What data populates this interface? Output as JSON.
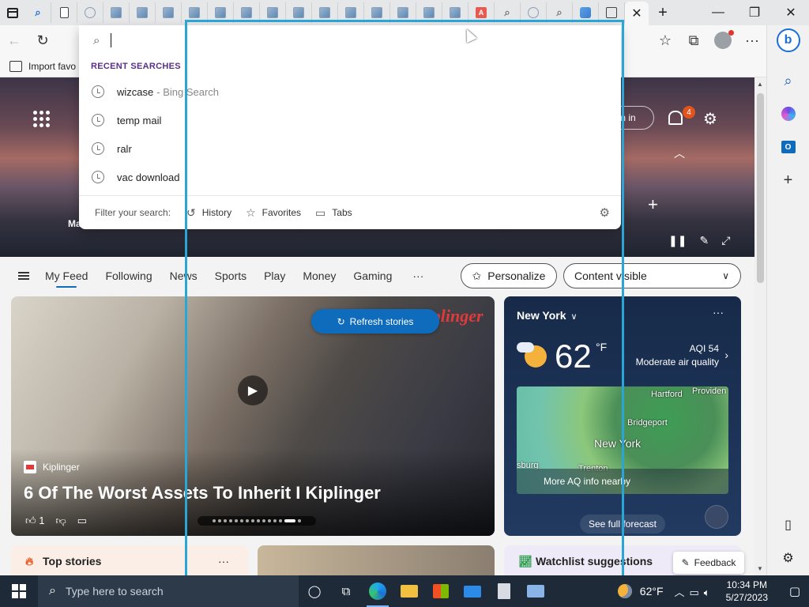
{
  "tabs": {
    "count_icons": [
      "search",
      "doc",
      "edge",
      "img",
      "img",
      "img",
      "img",
      "img",
      "img",
      "img",
      "img",
      "img",
      "img",
      "img",
      "img",
      "img",
      "img",
      "pdf",
      "mag",
      "edge",
      "mag",
      "ms",
      "win"
    ],
    "active_close": "✕",
    "new_tab": "+"
  },
  "window": {
    "minimize": "—",
    "maximize": "❐",
    "close": "✕"
  },
  "favbar": {
    "import_label": "Import favo"
  },
  "omnibox": {
    "recent_header": "RECENT SEARCHES",
    "items": [
      {
        "text": "wizcase",
        "suffix": "- Bing Search"
      },
      {
        "text": "temp mail",
        "suffix": ""
      },
      {
        "text": "ralr",
        "suffix": ""
      },
      {
        "text": "vac download",
        "suffix": ""
      }
    ],
    "filter_label": "Filter your search:",
    "filters": [
      {
        "label": "History",
        "icon": "history-icon"
      },
      {
        "label": "Favorites",
        "icon": "star-icon"
      },
      {
        "label": "Tabs",
        "icon": "tabs-icon"
      }
    ]
  },
  "hero": {
    "signin_label": "n in",
    "notifications": "4",
    "partial_label": "Ma"
  },
  "feed": {
    "nav": [
      "My Feed",
      "Following",
      "News",
      "Sports",
      "Play",
      "Money",
      "Gaming"
    ],
    "more": "···",
    "personalize": "Personalize",
    "content_visible": "Content visible"
  },
  "refresh": {
    "label": "Refresh stories"
  },
  "story": {
    "logo": "Kiplinger",
    "source": "Kiplinger",
    "headline": "6 Of The Worst Assets To Inherit I Kiplinger",
    "likes": "1"
  },
  "weather": {
    "city": "New York",
    "temp": "62",
    "unit": "°F",
    "aqi": "AQI 54",
    "aqi_desc": "Moderate air quality",
    "map_labels": [
      "Hartford",
      "Providen",
      "Bridgeport",
      "New York",
      "sburg",
      "Trenton"
    ],
    "aq_more": "More AQ info nearby",
    "forecast": "See full forecast"
  },
  "bottom_cards": {
    "top_stories": "Top stories",
    "watchlist": "Watchlist suggestions",
    "more": "···",
    "feedback": "Feedback"
  },
  "taskbar": {
    "search_placeholder": "Type here to search",
    "weather": "62°F",
    "time": "10:34 PM",
    "date": "5/27/2023"
  },
  "colors": {
    "accent": "#0f6cbd",
    "highlight": "#29a5d6",
    "taskbar": "#1f2a38",
    "recent_header": "#5a2f86"
  }
}
